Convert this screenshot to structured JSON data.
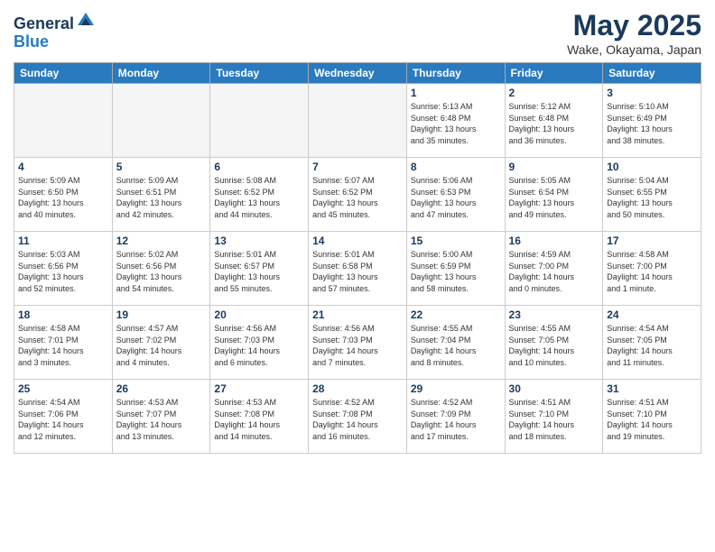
{
  "header": {
    "logo_general": "General",
    "logo_blue": "Blue",
    "month_title": "May 2025",
    "location": "Wake, Okayama, Japan"
  },
  "days_of_week": [
    "Sunday",
    "Monday",
    "Tuesday",
    "Wednesday",
    "Thursday",
    "Friday",
    "Saturday"
  ],
  "weeks": [
    [
      {
        "day": "",
        "empty": true
      },
      {
        "day": "",
        "empty": true
      },
      {
        "day": "",
        "empty": true
      },
      {
        "day": "",
        "empty": true
      },
      {
        "day": "1",
        "sunrise": "5:13 AM",
        "sunset": "6:48 PM",
        "daylight_hours": "13 hours",
        "daylight_minutes": "35 minutes"
      },
      {
        "day": "2",
        "sunrise": "5:12 AM",
        "sunset": "6:48 PM",
        "daylight_hours": "13 hours",
        "daylight_minutes": "36 minutes"
      },
      {
        "day": "3",
        "sunrise": "5:10 AM",
        "sunset": "6:49 PM",
        "daylight_hours": "13 hours",
        "daylight_minutes": "38 minutes"
      }
    ],
    [
      {
        "day": "4",
        "sunrise": "5:09 AM",
        "sunset": "6:50 PM",
        "daylight_hours": "13 hours",
        "daylight_minutes": "40 minutes"
      },
      {
        "day": "5",
        "sunrise": "5:09 AM",
        "sunset": "6:51 PM",
        "daylight_hours": "13 hours",
        "daylight_minutes": "42 minutes"
      },
      {
        "day": "6",
        "sunrise": "5:08 AM",
        "sunset": "6:52 PM",
        "daylight_hours": "13 hours",
        "daylight_minutes": "44 minutes"
      },
      {
        "day": "7",
        "sunrise": "5:07 AM",
        "sunset": "6:52 PM",
        "daylight_hours": "13 hours",
        "daylight_minutes": "45 minutes"
      },
      {
        "day": "8",
        "sunrise": "5:06 AM",
        "sunset": "6:53 PM",
        "daylight_hours": "13 hours",
        "daylight_minutes": "47 minutes"
      },
      {
        "day": "9",
        "sunrise": "5:05 AM",
        "sunset": "6:54 PM",
        "daylight_hours": "13 hours",
        "daylight_minutes": "49 minutes"
      },
      {
        "day": "10",
        "sunrise": "5:04 AM",
        "sunset": "6:55 PM",
        "daylight_hours": "13 hours",
        "daylight_minutes": "50 minutes"
      }
    ],
    [
      {
        "day": "11",
        "sunrise": "5:03 AM",
        "sunset": "6:56 PM",
        "daylight_hours": "13 hours",
        "daylight_minutes": "52 minutes"
      },
      {
        "day": "12",
        "sunrise": "5:02 AM",
        "sunset": "6:56 PM",
        "daylight_hours": "13 hours",
        "daylight_minutes": "54 minutes"
      },
      {
        "day": "13",
        "sunrise": "5:01 AM",
        "sunset": "6:57 PM",
        "daylight_hours": "13 hours",
        "daylight_minutes": "55 minutes"
      },
      {
        "day": "14",
        "sunrise": "5:01 AM",
        "sunset": "6:58 PM",
        "daylight_hours": "13 hours",
        "daylight_minutes": "57 minutes"
      },
      {
        "day": "15",
        "sunrise": "5:00 AM",
        "sunset": "6:59 PM",
        "daylight_hours": "13 hours",
        "daylight_minutes": "58 minutes"
      },
      {
        "day": "16",
        "sunrise": "4:59 AM",
        "sunset": "7:00 PM",
        "daylight_hours": "14 hours",
        "daylight_minutes": "0 minutes"
      },
      {
        "day": "17",
        "sunrise": "4:58 AM",
        "sunset": "7:00 PM",
        "daylight_hours": "14 hours",
        "daylight_minutes": "1 minute"
      }
    ],
    [
      {
        "day": "18",
        "sunrise": "4:58 AM",
        "sunset": "7:01 PM",
        "daylight_hours": "14 hours",
        "daylight_minutes": "3 minutes"
      },
      {
        "day": "19",
        "sunrise": "4:57 AM",
        "sunset": "7:02 PM",
        "daylight_hours": "14 hours",
        "daylight_minutes": "4 minutes"
      },
      {
        "day": "20",
        "sunrise": "4:56 AM",
        "sunset": "7:03 PM",
        "daylight_hours": "14 hours",
        "daylight_minutes": "6 minutes"
      },
      {
        "day": "21",
        "sunrise": "4:56 AM",
        "sunset": "7:03 PM",
        "daylight_hours": "14 hours",
        "daylight_minutes": "7 minutes"
      },
      {
        "day": "22",
        "sunrise": "4:55 AM",
        "sunset": "7:04 PM",
        "daylight_hours": "14 hours",
        "daylight_minutes": "8 minutes"
      },
      {
        "day": "23",
        "sunrise": "4:55 AM",
        "sunset": "7:05 PM",
        "daylight_hours": "14 hours",
        "daylight_minutes": "10 minutes"
      },
      {
        "day": "24",
        "sunrise": "4:54 AM",
        "sunset": "7:05 PM",
        "daylight_hours": "14 hours",
        "daylight_minutes": "11 minutes"
      }
    ],
    [
      {
        "day": "25",
        "sunrise": "4:54 AM",
        "sunset": "7:06 PM",
        "daylight_hours": "14 hours",
        "daylight_minutes": "12 minutes"
      },
      {
        "day": "26",
        "sunrise": "4:53 AM",
        "sunset": "7:07 PM",
        "daylight_hours": "14 hours",
        "daylight_minutes": "13 minutes"
      },
      {
        "day": "27",
        "sunrise": "4:53 AM",
        "sunset": "7:08 PM",
        "daylight_hours": "14 hours",
        "daylight_minutes": "14 minutes"
      },
      {
        "day": "28",
        "sunrise": "4:52 AM",
        "sunset": "7:08 PM",
        "daylight_hours": "14 hours",
        "daylight_minutes": "16 minutes"
      },
      {
        "day": "29",
        "sunrise": "4:52 AM",
        "sunset": "7:09 PM",
        "daylight_hours": "14 hours",
        "daylight_minutes": "17 minutes"
      },
      {
        "day": "30",
        "sunrise": "4:51 AM",
        "sunset": "7:10 PM",
        "daylight_hours": "14 hours",
        "daylight_minutes": "18 minutes"
      },
      {
        "day": "31",
        "sunrise": "4:51 AM",
        "sunset": "7:10 PM",
        "daylight_hours": "14 hours",
        "daylight_minutes": "19 minutes"
      }
    ]
  ]
}
